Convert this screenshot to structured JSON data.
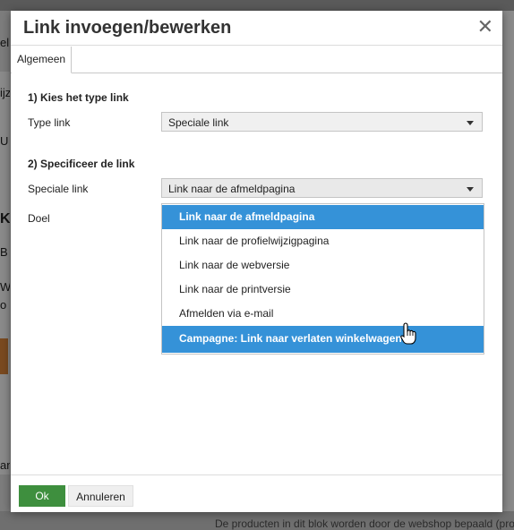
{
  "background": {
    "fragments": [
      "el",
      "ijz",
      "U",
      "K",
      "B",
      "W",
      "o",
      "an"
    ],
    "bottom_text": "De producten in dit blok worden door de webshop bepaald (producti"
  },
  "dialog": {
    "title": "Link invoegen/bewerken",
    "close_icon": "close-icon",
    "tabs": [
      "Algemeen"
    ],
    "section1_title": "1) Kies het type link",
    "type_link_label": "Type link",
    "type_link_value": "Speciale link",
    "section2_title": "2) Specificeer de link",
    "speciale_link_label": "Speciale link",
    "speciale_link_value": "Link naar de afmeldpagina",
    "doel_label": "Doel",
    "options": [
      "Link naar de afmeldpagina",
      "Link naar de profielwijzigpagina",
      "Link naar de webversie",
      "Link naar de printversie",
      "Afmelden via e-mail",
      "Campagne: Link naar verlaten winkelwagen"
    ],
    "ok_label": "Ok",
    "cancel_label": "Annuleren"
  },
  "colors": {
    "accent": "#3592d8",
    "ok_button": "#3e8f3e"
  }
}
